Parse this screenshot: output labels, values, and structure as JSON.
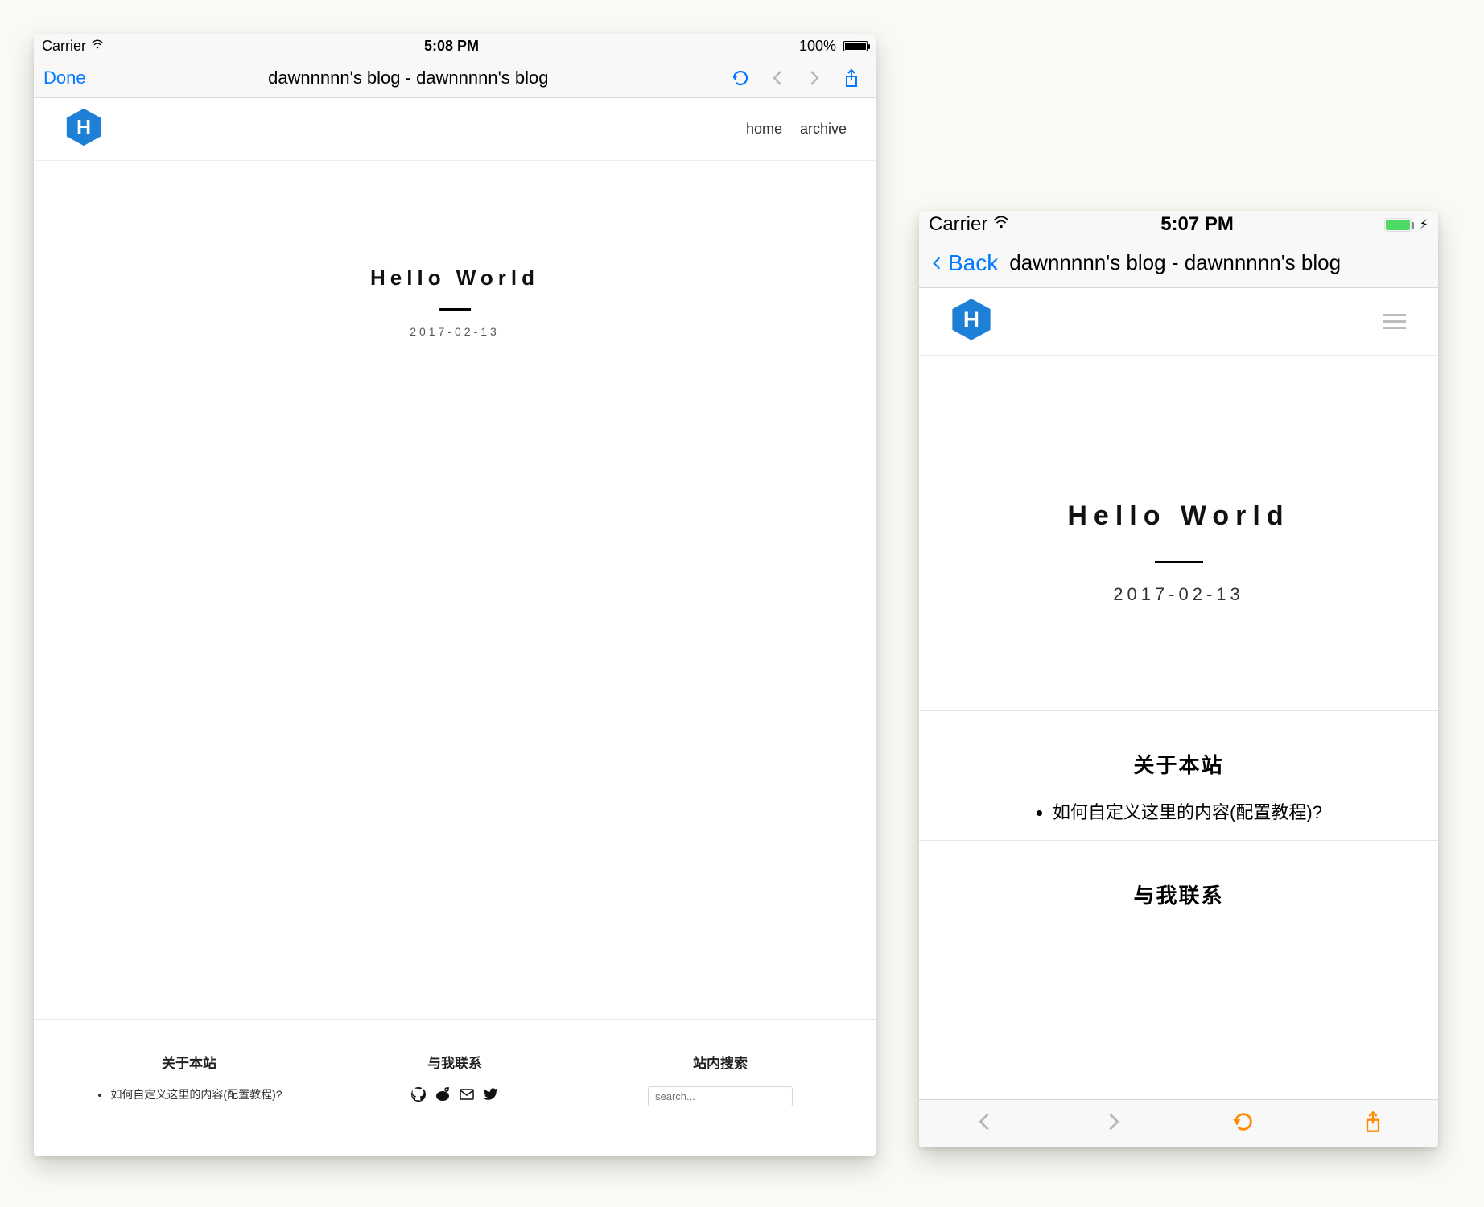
{
  "ipad": {
    "statusbar": {
      "carrier": "Carrier",
      "time": "5:08 PM",
      "battery": "100%"
    },
    "navbar": {
      "done": "Done",
      "title": "dawnnnnn's blog - dawnnnnn's blog"
    },
    "blog": {
      "logo_letter": "H",
      "nav": [
        "home",
        "archive"
      ],
      "post_title": "Hello World",
      "post_date": "2017-02-13",
      "footer": {
        "about_heading": "关于本站",
        "about_item": "如何自定义这里的内容(配置教程)?",
        "contact_heading": "与我联系",
        "search_heading": "站内搜索",
        "search_placeholder": "search..."
      }
    }
  },
  "iphone": {
    "statusbar": {
      "carrier": "Carrier",
      "time": "5:07 PM"
    },
    "navbar": {
      "back": "Back",
      "title": "dawnnnnn's blog - dawnnnnn's blog"
    },
    "blog": {
      "logo_letter": "H",
      "post_title": "Hello World",
      "post_date": "2017-02-13",
      "about_heading": "关于本站",
      "about_item": "如何自定义这里的内容(配置教程)?",
      "contact_heading": "与我联系"
    }
  },
  "colors": {
    "ios_blue": "#007aff",
    "ios_orange": "#ff8a00",
    "logo_blue": "#1e7fd6",
    "battery_green": "#4cd964"
  }
}
